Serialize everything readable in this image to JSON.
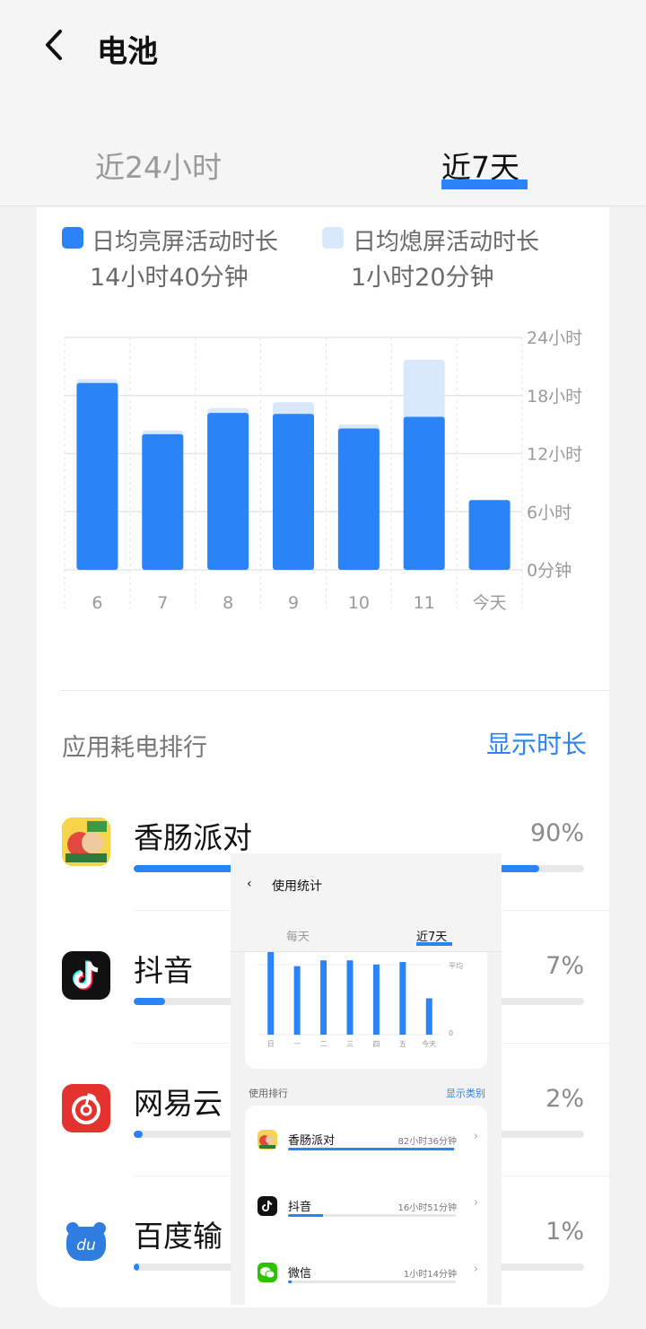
{
  "header": {
    "title": "电池",
    "tabs": [
      "近24小时",
      "近7天"
    ],
    "active_tab": "近7天"
  },
  "legend": {
    "screen_on_label": "日均亮屏活动时长",
    "screen_on_value": "14小时40分钟",
    "screen_off_label": "日均熄屏活动时长",
    "screen_off_value": "1小时20分钟"
  },
  "colors": {
    "accent": "#2b84f7",
    "screen_off": "#d9e8fc"
  },
  "chart_data": {
    "type": "bar",
    "stacked": true,
    "categories": [
      "6",
      "7",
      "8",
      "9",
      "10",
      "11",
      "今天"
    ],
    "series": [
      {
        "name": "日均亮屏活动时长",
        "unit": "小时",
        "values": [
          19.3,
          14.0,
          16.2,
          16.1,
          14.6,
          15.8,
          7.2
        ]
      },
      {
        "name": "日均熄屏活动时长",
        "unit": "小时",
        "values": [
          0.4,
          0.4,
          0.5,
          1.2,
          0.4,
          5.9,
          0
        ]
      }
    ],
    "y_tick_labels": [
      "0分钟",
      "6小时",
      "12小时",
      "18小时",
      "24小时"
    ],
    "ylim": [
      0,
      24
    ],
    "grid": true,
    "y_axis_position": "right"
  },
  "ranking": {
    "title": "应用耗电排行",
    "toggle_label": "显示时长",
    "apps": [
      {
        "name": "香肠派对",
        "percent_label": "90%",
        "share": 0.9,
        "icon": "sausage-party-icon"
      },
      {
        "name": "抖音",
        "percent_label": "7%",
        "share": 0.07,
        "icon": "douyin-icon"
      },
      {
        "name": "网易云",
        "percent_label": "2%",
        "share": 0.02,
        "icon": "netease-music-icon"
      },
      {
        "name": "百度输",
        "percent_label": "1%",
        "share": 0.01,
        "icon": "baidu-input-icon"
      }
    ]
  },
  "overlay": {
    "title": "使用统计",
    "tabs": [
      "每天",
      "近7天"
    ],
    "active_tab": "近7天",
    "chart_data": {
      "type": "bar",
      "categories": [
        "日",
        "一",
        "二",
        "三",
        "四",
        "五",
        "今天"
      ],
      "values": [
        1.0,
        0.83,
        0.9,
        0.9,
        0.85,
        0.88,
        0.44
      ],
      "y_tick_labels": [
        "平均",
        "0"
      ]
    },
    "rank_title": "使用排行",
    "rank_toggle": "显示类别",
    "apps": [
      {
        "name": "香肠派对",
        "duration": "82小时36分钟",
        "share": 0.99,
        "icon": "sausage-party-icon"
      },
      {
        "name": "抖音",
        "duration": "16小时51分钟",
        "share": 0.21,
        "icon": "douyin-icon"
      },
      {
        "name": "微信",
        "duration": "1小时14分钟",
        "share": 0.02,
        "icon": "wechat-icon"
      }
    ]
  }
}
